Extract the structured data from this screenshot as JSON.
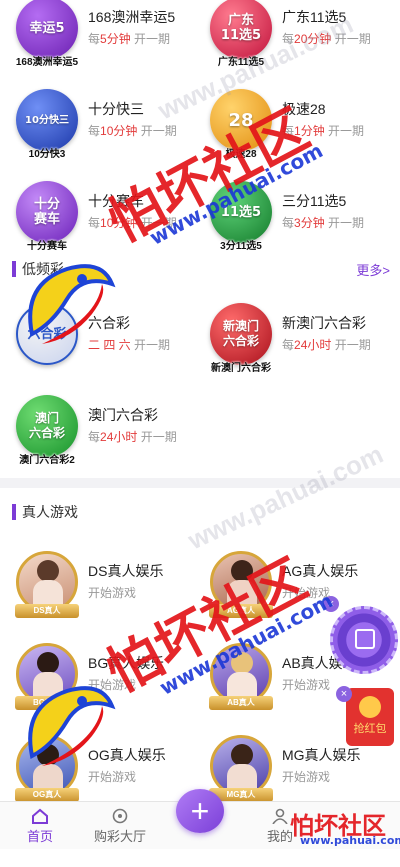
{
  "top_grid": [
    {
      "name": "168澳洲幸运5",
      "prefix": "每",
      "value": "5分钟",
      "suffix": "开一期",
      "logo_text": "幸运5",
      "logo_caption": "168澳洲幸运5",
      "color": "#7b2fbf"
    },
    {
      "name": "广东11选5",
      "prefix": "每",
      "value": "20分钟",
      "suffix": "开一期",
      "logo_text": "广东\n11选5",
      "logo_caption": "广东11选5",
      "color": "#d6254a"
    },
    {
      "name": "十分快三",
      "prefix": "每",
      "value": "10分钟",
      "suffix": "开一期",
      "logo_text": "10分快三",
      "logo_caption": "10分快3",
      "color": "#2f4fc9"
    },
    {
      "name": "极速28",
      "prefix": "每",
      "value": "1分钟",
      "suffix": "开一期",
      "logo_text": "28",
      "logo_caption": "极速28",
      "color": "#f0a321"
    },
    {
      "name": "十分赛车",
      "prefix": "每",
      "value": "10分钟",
      "suffix": "开一期",
      "logo_text": "十分\n赛车",
      "logo_caption": "十分赛车",
      "color": "#8a3bd8"
    },
    {
      "name": "三分11选5",
      "prefix": "每",
      "value": "3分钟",
      "suffix": "开一期",
      "logo_text": "11选5",
      "logo_caption": "3分11选5",
      "color": "#1e9e3a"
    }
  ],
  "low_freq": {
    "title": "低频彩",
    "more": "更多>",
    "items": [
      {
        "name": "六合彩",
        "prefix": "",
        "value": "二 四 六",
        "suffix": "开一期",
        "logo_text": "六合彩",
        "logo_caption": "",
        "color": "#2b57c7"
      },
      {
        "name": "新澳门六合彩",
        "prefix": "每",
        "value": "24小时",
        "suffix": "开一期",
        "logo_text": "新澳门\n六合彩",
        "logo_caption": "新澳门六合彩",
        "color": "#c2202a"
      },
      {
        "name": "澳门六合彩",
        "prefix": "每",
        "value": "24小时",
        "suffix": "开一期",
        "logo_text": "澳门\n六合彩",
        "logo_caption": "澳门六合彩2",
        "color": "#1e9e3a"
      }
    ]
  },
  "live": {
    "title": "真人游戏",
    "items": [
      {
        "name": "DS真人娱乐",
        "sub": "开始游戏",
        "badge": "DS真人"
      },
      {
        "name": "AG真人娱乐",
        "sub": "开始游戏",
        "badge": "AG真人"
      },
      {
        "name": "BG真人娱乐",
        "sub": "开始游戏",
        "badge": "BG真人"
      },
      {
        "name": "AB真人娱乐",
        "sub": "开始游戏",
        "badge": "AB真人"
      },
      {
        "name": "OG真人娱乐",
        "sub": "开始游戏",
        "badge": "OG真人"
      },
      {
        "name": "MG真人娱乐",
        "sub": "开始游戏",
        "badge": "MG真人"
      }
    ]
  },
  "float": {
    "red_envelope": "抢红包",
    "close": "×"
  },
  "tabbar": {
    "home": "首页",
    "hall": "购彩大厅",
    "plus": "+",
    "user": "我的"
  },
  "watermark": {
    "brand": "怕坏社区",
    "url": "www.pahuai.com",
    "corner_brand": "怕坏社区",
    "corner_url": "www.pahuai.com"
  }
}
